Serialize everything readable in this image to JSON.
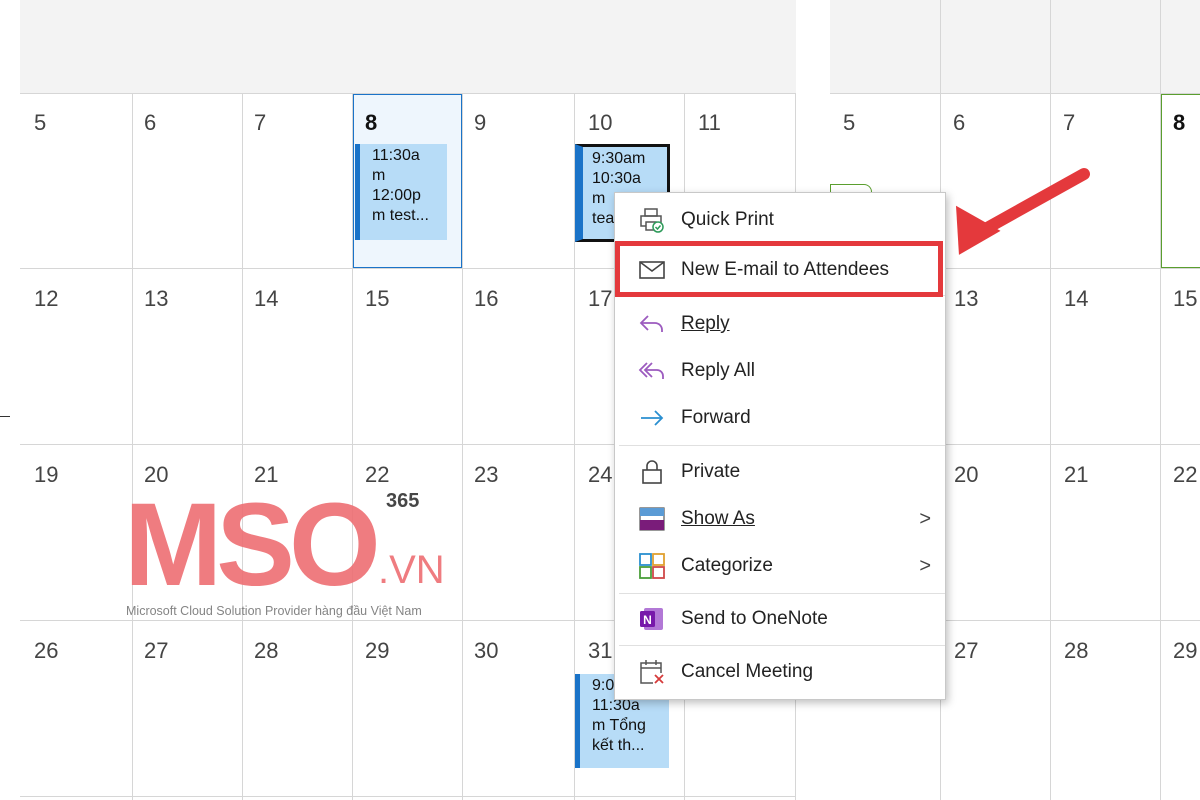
{
  "calendar_left": {
    "week_rows": [
      [
        "5",
        "6",
        "7",
        "8",
        "9",
        "10",
        "11"
      ],
      [
        "12",
        "13",
        "14",
        "15",
        "16",
        "17",
        ""
      ],
      [
        "19",
        "20",
        "21",
        "22",
        "23",
        "24",
        ""
      ],
      [
        "26",
        "27",
        "28",
        "29",
        "30",
        "31",
        ""
      ]
    ],
    "today": "8",
    "events": [
      {
        "text": "11:30a\nm\n12:00p\nm test..."
      },
      {
        "text": "9:30am\n10:30a\nm \ntea"
      },
      {
        "text": "9:0\n11:30a\nm Tổng\nkết th..."
      }
    ]
  },
  "calendar_right": {
    "week_rows": [
      [
        "5",
        "6",
        "7",
        "8"
      ],
      [
        "13",
        "14",
        "15"
      ],
      [
        "20",
        "21",
        "22"
      ],
      [
        "27",
        "28",
        "29"
      ]
    ]
  },
  "watermark": {
    "logo_letters": "MSO",
    "suffix": ".VN",
    "badge": "365",
    "tagline": "Microsoft Cloud Solution Provider hàng đầu Việt Nam"
  },
  "context_menu": {
    "items": [
      {
        "label": "Quick Print",
        "icon": "printer-icon"
      },
      {
        "label": "New E-mail to Attendees",
        "icon": "envelope-icon",
        "highlighted": true
      },
      {
        "label": "Reply",
        "icon": "reply-icon"
      },
      {
        "label": "Reply All",
        "icon": "reply-all-icon"
      },
      {
        "label": "Forward",
        "icon": "forward-icon"
      },
      {
        "label": "Private",
        "icon": "lock-icon"
      },
      {
        "label": "Show As",
        "icon": "show-as-icon",
        "submenu": true
      },
      {
        "label": "Categorize",
        "icon": "categorize-icon",
        "submenu": true
      },
      {
        "label": "Send to OneNote",
        "icon": "onenote-icon"
      },
      {
        "label": "Cancel Meeting",
        "icon": "cancel-meeting-icon"
      }
    ],
    "submenu_glyph": ">"
  },
  "colors": {
    "highlight_red": "#e4393c",
    "event_fill": "#b7dcf7",
    "event_bar": "#1a73c8",
    "watermark": "#ee6e73",
    "today_border": "#1a73c8",
    "right_today_border": "#5a9e2e"
  }
}
